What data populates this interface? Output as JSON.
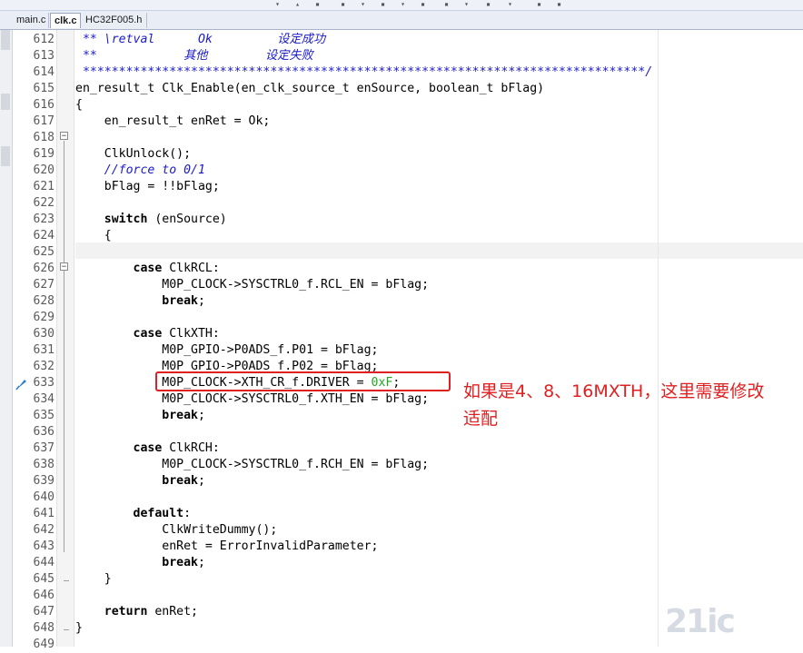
{
  "tabs": [
    {
      "label": "main.c",
      "active": false
    },
    {
      "label": "clk.c",
      "active": true
    },
    {
      "label": "HC32F005.h",
      "active": false
    }
  ],
  "editor": {
    "lines": [
      {
        "num": "612",
        "parts": [
          {
            "t": " ** \\retval      Ok         设定成功",
            "c": "cmt"
          }
        ]
      },
      {
        "num": "613",
        "parts": [
          {
            "t": " **            其他        设定失败",
            "c": "cmt"
          }
        ]
      },
      {
        "num": "614",
        "parts": [
          {
            "t": " ******************************************************************************/",
            "c": "cmt"
          }
        ]
      },
      {
        "num": "615",
        "parts": [
          {
            "t": "en_result_t Clk_Enable(en_clk_source_t enSource, boolean_t bFlag)",
            "c": ""
          }
        ]
      },
      {
        "num": "616",
        "parts": [
          {
            "t": "{",
            "c": ""
          }
        ]
      },
      {
        "num": "617",
        "parts": [
          {
            "t": "    en_result_t enRet = Ok;",
            "c": ""
          }
        ]
      },
      {
        "num": "618",
        "parts": []
      },
      {
        "num": "619",
        "parts": [
          {
            "t": "    ClkUnlock();",
            "c": ""
          }
        ]
      },
      {
        "num": "620",
        "parts": [
          {
            "t": "    //force to 0/1",
            "c": "cmt"
          }
        ]
      },
      {
        "num": "621",
        "parts": [
          {
            "t": "    bFlag = !!bFlag;",
            "c": ""
          }
        ]
      },
      {
        "num": "622",
        "parts": []
      },
      {
        "num": "623",
        "parts": [
          {
            "t": "    ",
            "c": ""
          },
          {
            "t": "switch",
            "c": "kw"
          },
          {
            "t": " (enSource)",
            "c": ""
          }
        ]
      },
      {
        "num": "624",
        "parts": [
          {
            "t": "    {",
            "c": ""
          }
        ]
      },
      {
        "num": "625",
        "parts": []
      },
      {
        "num": "626",
        "parts": [
          {
            "t": "        ",
            "c": ""
          },
          {
            "t": "case",
            "c": "kw"
          },
          {
            "t": " ClkRCL:",
            "c": ""
          }
        ]
      },
      {
        "num": "627",
        "parts": [
          {
            "t": "            M0P_CLOCK->SYSCTRL0_f.RCL_EN = bFlag;",
            "c": ""
          }
        ]
      },
      {
        "num": "628",
        "parts": [
          {
            "t": "            ",
            "c": ""
          },
          {
            "t": "break",
            "c": "kw"
          },
          {
            "t": ";",
            "c": ""
          }
        ]
      },
      {
        "num": "629",
        "parts": []
      },
      {
        "num": "630",
        "parts": [
          {
            "t": "        ",
            "c": ""
          },
          {
            "t": "case",
            "c": "kw"
          },
          {
            "t": " ClkXTH:",
            "c": ""
          }
        ]
      },
      {
        "num": "631",
        "parts": [
          {
            "t": "            M0P_GPIO->P0ADS_f.P01 = bFlag;",
            "c": ""
          }
        ]
      },
      {
        "num": "632",
        "parts": [
          {
            "t": "            M0P_GPIO->P0ADS_f.P02 = bFlag;",
            "c": ""
          }
        ]
      },
      {
        "num": "633",
        "parts": [
          {
            "t": "            M0P_CLOCK->XTH_CR_f.DRIVER = ",
            "c": ""
          },
          {
            "t": "0xF",
            "c": "num"
          },
          {
            "t": ";",
            "c": ""
          }
        ]
      },
      {
        "num": "634",
        "parts": [
          {
            "t": "            M0P_CLOCK->SYSCTRL0_f.XTH_EN = bFlag;",
            "c": ""
          }
        ]
      },
      {
        "num": "635",
        "parts": [
          {
            "t": "            ",
            "c": ""
          },
          {
            "t": "break",
            "c": "kw"
          },
          {
            "t": ";",
            "c": ""
          }
        ]
      },
      {
        "num": "636",
        "parts": []
      },
      {
        "num": "637",
        "parts": [
          {
            "t": "        ",
            "c": ""
          },
          {
            "t": "case",
            "c": "kw"
          },
          {
            "t": " ClkRCH:",
            "c": ""
          }
        ]
      },
      {
        "num": "638",
        "parts": [
          {
            "t": "            M0P_CLOCK->SYSCTRL0_f.RCH_EN = bFlag;",
            "c": ""
          }
        ]
      },
      {
        "num": "639",
        "parts": [
          {
            "t": "            ",
            "c": ""
          },
          {
            "t": "break",
            "c": "kw"
          },
          {
            "t": ";",
            "c": ""
          }
        ]
      },
      {
        "num": "640",
        "parts": []
      },
      {
        "num": "641",
        "parts": [
          {
            "t": "        ",
            "c": ""
          },
          {
            "t": "default",
            "c": "kw"
          },
          {
            "t": ":",
            "c": ""
          }
        ]
      },
      {
        "num": "642",
        "parts": [
          {
            "t": "            ClkWriteDummy();",
            "c": ""
          }
        ]
      },
      {
        "num": "643",
        "parts": [
          {
            "t": "            enRet = ErrorInvalidParameter;",
            "c": ""
          }
        ]
      },
      {
        "num": "644",
        "parts": [
          {
            "t": "            ",
            "c": ""
          },
          {
            "t": "break",
            "c": "kw"
          },
          {
            "t": ";",
            "c": ""
          }
        ]
      },
      {
        "num": "645",
        "parts": [
          {
            "t": "    }",
            "c": ""
          }
        ]
      },
      {
        "num": "646",
        "parts": []
      },
      {
        "num": "647",
        "parts": [
          {
            "t": "    ",
            "c": ""
          },
          {
            "t": "return",
            "c": "kw"
          },
          {
            "t": " enRet;",
            "c": ""
          }
        ]
      },
      {
        "num": "648",
        "parts": [
          {
            "t": "}",
            "c": ""
          }
        ]
      },
      {
        "num": "649",
        "parts": []
      }
    ],
    "current_line": "625",
    "bookmark_line": "633"
  },
  "annotation": {
    "text_line1": "如果是4、8、16MXTH，这里需要修改",
    "text_line2": "适配",
    "color": "#e02020"
  },
  "watermark": {
    "text": "21ic"
  },
  "colors": {
    "comment": "#1a1acc",
    "number": "#1fa81f",
    "current_line_bg": "#f2f2f2"
  },
  "icons": [
    "bookmark-arrow-icon",
    "fold-minus-icon"
  ]
}
